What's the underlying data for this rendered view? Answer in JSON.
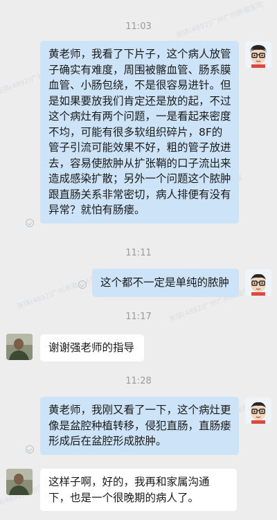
{
  "conversation": {
    "watermark_text": "张琪(4892)广州广州肿瘤医院",
    "watermark_text_2": "张琪(4892)广州市第一人民医院",
    "messages": [
      {
        "time": "11:03",
        "sender": "outgoing",
        "text": "黄老师，我看了下片子，这个病人放管子确实有难度，周围被髂血管、肠系膜血管、小肠包绕，不是很容易进针。但是如果要放我们肯定还是放的起，不过这个病灶有两个问题，一是看起来密度不均，可能有很多软组织碎片，8F的管子引流可能效果不好，粗的管子放进去，容易使脓肿从扩张鞘的口子流出来造成感染扩散；另外一个问题这个脓肿跟直肠关系非常密切，病人排便有没有异常？就怕有肠瘘。"
      },
      {
        "time": "11:11",
        "sender": "outgoing",
        "text": "这个都不一定是单纯的脓肿"
      },
      {
        "time": "11:17",
        "sender": "incoming",
        "text": "谢谢强老师的指导"
      },
      {
        "time": "11:28",
        "sender": "outgoing",
        "text": "黄老师，我刚又看了一下，这个病灶更像是盆腔种植转移，侵犯直肠，直肠瘘形成后在盆腔形成脓肿。"
      },
      {
        "sender": "incoming",
        "text": "这样子啊，好的，我再和家属沟通下，也是一个很晚期的病人了。"
      }
    ]
  },
  "colors": {
    "background": "#ededed",
    "outgoing_bubble": "#cde3f7",
    "incoming_bubble": "#ffffff",
    "timestamp": "#9a9a9a"
  }
}
